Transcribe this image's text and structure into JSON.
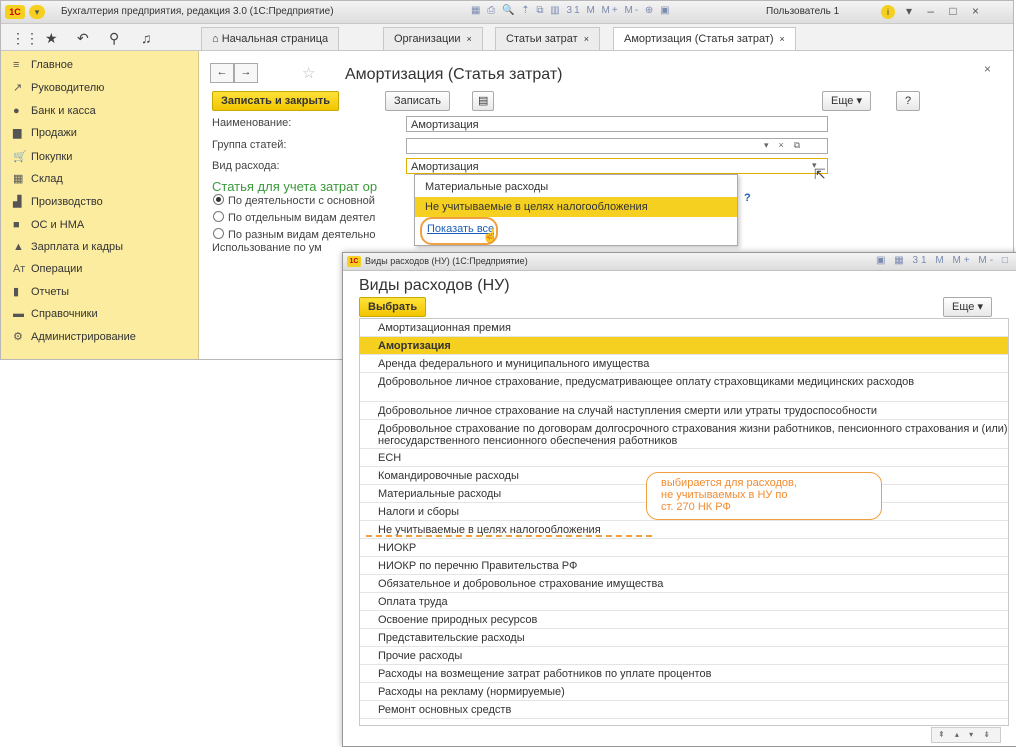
{
  "titlebar": {
    "logo": "1С",
    "title": "Бухгалтерия предприятия, редакция 3.0 (1С:Предприятие)",
    "toolbar_icons": "▦ ⎙ 🔍 ⇡ ⧉ ▥ 31  M M+ M-  ⊕ ▣",
    "user": "Пользователь 1",
    "window_buttons": "▾ – □ ×"
  },
  "tabs": {
    "home": "Начальная страница",
    "items": [
      {
        "label": "Организации",
        "close": "×"
      },
      {
        "label": "Статьи затрат",
        "close": "×"
      },
      {
        "label": "Амортизация (Статья затрат)",
        "close": "×"
      }
    ]
  },
  "sidebar": {
    "items": [
      {
        "icon": "≡",
        "label": "Главное"
      },
      {
        "icon": "↗",
        "label": "Руководителю"
      },
      {
        "icon": "●",
        "label": "Банк и касса"
      },
      {
        "icon": "▆",
        "label": "Продажи"
      },
      {
        "icon": "🛒",
        "label": "Покупки"
      },
      {
        "icon": "▦",
        "label": "Склад"
      },
      {
        "icon": "▟",
        "label": "Производство"
      },
      {
        "icon": "■",
        "label": "ОС и НМА"
      },
      {
        "icon": "▲",
        "label": "Зарплата и кадры"
      },
      {
        "icon": "Ат",
        "label": "Операции"
      },
      {
        "icon": "▮",
        "label": "Отчеты"
      },
      {
        "icon": "▬",
        "label": "Справочники"
      },
      {
        "icon": "⚙",
        "label": "Администрирование"
      }
    ]
  },
  "form": {
    "title": "Амортизация (Статья затрат)",
    "star": "☆",
    "close": "×",
    "back": "←",
    "forward": "→",
    "save_close": "Записать и закрыть",
    "save": "Записать",
    "more": "Еще ▾",
    "help": "?",
    "name_label": "Наименование:",
    "name_value": "Амортизация",
    "group_label": "Группа статей:",
    "expense_label": "Вид расхода:",
    "expense_value": "Амортизация",
    "section_title": "Статья для учета затрат ор",
    "radio1": "По деятельности с основной",
    "radio2": "По отдельным видам деятел",
    "radio3": "По разным видам деятельно",
    "usage_label": "Использование по ум"
  },
  "dropdown": {
    "items": [
      "Материальные расходы",
      "Не учитываемые в целях налогообложения"
    ],
    "show_all": "Показать все"
  },
  "popup": {
    "window_title": "Виды расходов (НУ) (1С:Предприятие)",
    "title": "Виды расходов (НУ)",
    "select": "Выбрать",
    "more": "Еще ▾",
    "rows": [
      {
        "label": "Амортизационная премия",
        "selected": false
      },
      {
        "label": "Амортизация",
        "selected": true
      },
      {
        "label": "Аренда федерального и муниципального имущества",
        "selected": false
      },
      {
        "label": "Добровольное личное страхование, предусматривающее оплату страховщиками медицинских расходов",
        "selected": false
      },
      {
        "label": "Добровольное личное страхование на случай наступления смерти или утраты трудоспособности",
        "selected": false
      },
      {
        "label": "Добровольное страхование по договорам долгосрочного страхования жизни работников, пенсионного страхования и (или) негосударственного пенсионного обеспечения работников",
        "selected": false
      },
      {
        "label": "ЕСН",
        "selected": false
      },
      {
        "label": "Командировочные расходы",
        "selected": false
      },
      {
        "label": "Материальные расходы",
        "selected": false
      },
      {
        "label": "Налоги и сборы",
        "selected": false
      },
      {
        "label": "Не учитываемые в целях налогообложения",
        "selected": false
      },
      {
        "label": "НИОКР",
        "selected": false
      },
      {
        "label": "НИОКР по перечню Правительства РФ",
        "selected": false
      },
      {
        "label": "Обязательное и добровольное страхование имущества",
        "selected": false
      },
      {
        "label": "Оплата труда",
        "selected": false
      },
      {
        "label": "Освоение природных ресурсов",
        "selected": false
      },
      {
        "label": "Представительские расходы",
        "selected": false
      },
      {
        "label": "Прочие расходы",
        "selected": false
      },
      {
        "label": "Расходы на возмещение затрат работников по уплате процентов",
        "selected": false
      },
      {
        "label": "Расходы на рекламу (нормируемые)",
        "selected": false
      },
      {
        "label": "Ремонт основных средств",
        "selected": false
      }
    ],
    "footer": "⇞ ▴ ▾ ⇟"
  },
  "callout": {
    "text": [
      "выбирается для расходов,",
      "не учитываемых в НУ по",
      "ст. 270 НК РФ"
    ]
  },
  "colors": {
    "accent": "#f5d020",
    "sidebar": "#fbeca0",
    "callout": "#f0a040",
    "section": "#3a9a3a"
  }
}
